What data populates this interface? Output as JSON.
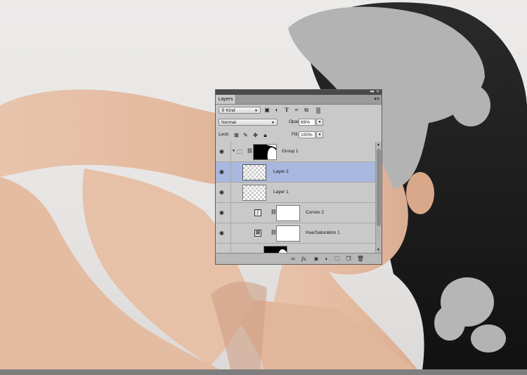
{
  "panel": {
    "title": "Layers",
    "collapse_glyph": "◂◂",
    "close_glyph": "✕",
    "menu_glyph": "▾≡",
    "filter": {
      "value": "Kind",
      "icon": "search-icon"
    },
    "filter_icons": [
      "image-filter-icon",
      "adjustment-filter-icon",
      "type-filter-icon",
      "shape-filter-icon",
      "smart-object-filter-icon"
    ],
    "blend_mode": "Normal",
    "opacity_label": "Opacity:",
    "opacity_value": "69%",
    "lock_label": "Lock:",
    "fill_label": "Fill:",
    "fill_value": "100%",
    "layers": [
      {
        "name": "Group 1",
        "type": "group",
        "visible": true,
        "selected": false
      },
      {
        "name": "Layer 2",
        "type": "pixel",
        "visible": true,
        "selected": true
      },
      {
        "name": "Layer 1",
        "type": "pixel",
        "visible": true,
        "selected": false
      },
      {
        "name": "Curves 2",
        "type": "adjustment-curves",
        "visible": true,
        "selected": false
      },
      {
        "name": "Hue/Saturation 1",
        "type": "adjustment-hue-saturation",
        "visible": true,
        "selected": false
      }
    ],
    "bottom_icons": [
      "link-layers-icon",
      "fx-icon",
      "add-mask-icon",
      "new-adjustment-layer-icon",
      "new-group-icon",
      "new-layer-icon",
      "delete-layer-icon"
    ]
  },
  "colors": {
    "panel_bg": "#c9c9c9",
    "selected_row": "#a8b8de",
    "photo_bg": "#e8e6e4",
    "skin": "#e5bfa5",
    "hair": "#1a1a1a",
    "painted_gray": "#b3b3b3"
  }
}
